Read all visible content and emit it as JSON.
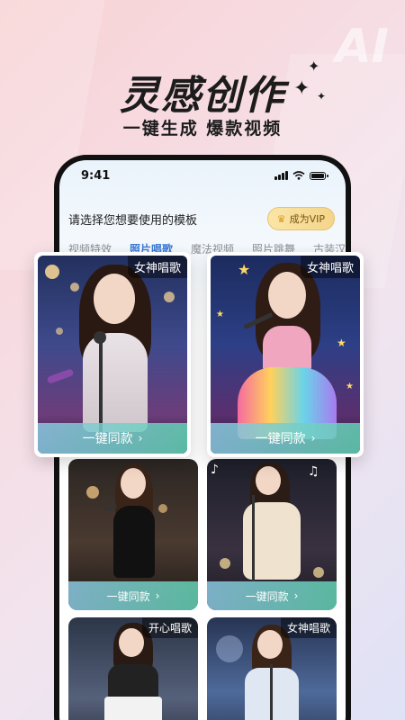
{
  "promo": {
    "headline": "灵感创作",
    "subline": "一键生成 爆款视频",
    "bg_text": "AI"
  },
  "status_bar": {
    "time": "9:41"
  },
  "app": {
    "prompt": "请选择您想要使用的模板",
    "vip_label": "成为VIP",
    "tabs": [
      "视频特效",
      "照片唱歌",
      "魔法视频",
      "照片跳舞",
      "古装汉"
    ],
    "active_tab": "照片唱歌"
  },
  "featured_cards": [
    {
      "tag": "女神唱歌",
      "cta": "一键同款"
    },
    {
      "tag": "女神唱歌",
      "cta": "一键同款"
    }
  ],
  "grid_cards": [
    {
      "tag": "",
      "cta": "一键同款"
    },
    {
      "tag": "",
      "cta": "一键同款"
    },
    {
      "tag": "开心唱歌",
      "cta": ""
    },
    {
      "tag": "女神唱歌",
      "cta": ""
    }
  ],
  "colors": {
    "accent": "#3c7bd6",
    "cta_gradient_start": "#8cc8e1",
    "cta_gradient_end": "#64d2b4",
    "vip_gold": "#f4d58a"
  }
}
